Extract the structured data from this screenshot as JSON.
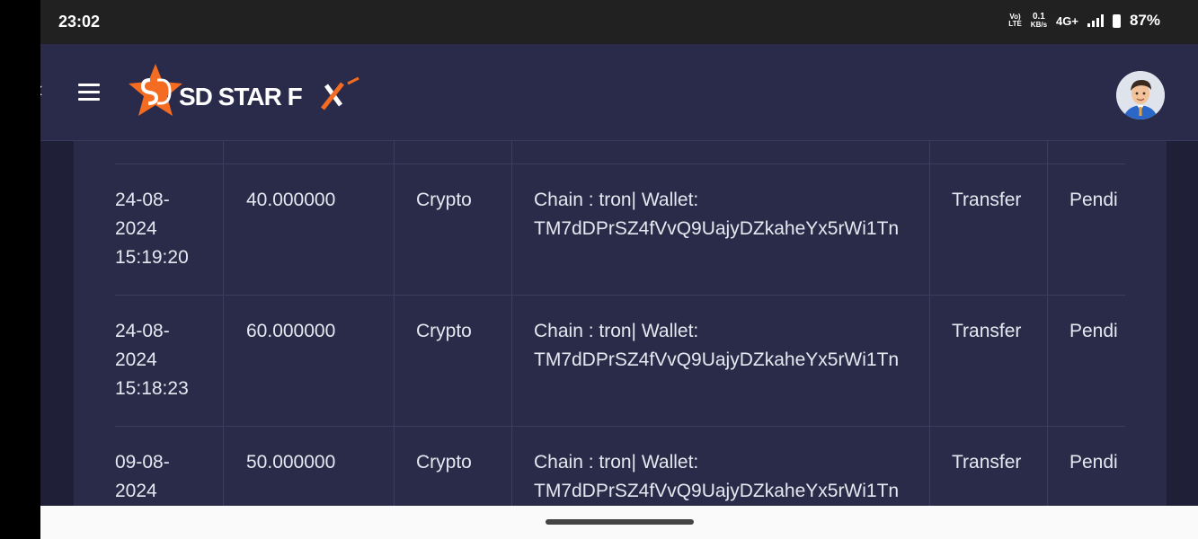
{
  "status_bar": {
    "time": "23:02",
    "volte_top": "Vo)",
    "volte_bottom": "LTE",
    "speed_value": "0.1",
    "speed_unit": "KB/s",
    "network": "4G+",
    "battery": "87%"
  },
  "header": {
    "logo_text": "SDSTARFX",
    "menu_icon": "hamburger-menu-icon",
    "avatar_icon": "user-avatar"
  },
  "colors": {
    "header_bg": "#2a2b4a",
    "card_bg": "#2a2b48",
    "page_bg": "#1f1f38",
    "accent_orange": "#f36c21",
    "text": "#e6e7f0"
  },
  "table": {
    "rows": [
      {
        "date_d": "24-08-",
        "date_y": "2024",
        "time": "15:19:20",
        "amount": "40.000000",
        "method": "Crypto",
        "details_1": "Chain : tron| Wallet:",
        "details_2": "TM7dDPrSZ4fVvQ9UajyDZkaheYx5rWi1Tn",
        "type": "Transfer",
        "status": "Pendi"
      },
      {
        "date_d": "24-08-",
        "date_y": "2024",
        "time": "15:18:23",
        "amount": "60.000000",
        "method": "Crypto",
        "details_1": "Chain : tron| Wallet:",
        "details_2": "TM7dDPrSZ4fVvQ9UajyDZkaheYx5rWi1Tn",
        "type": "Transfer",
        "status": "Pendi"
      },
      {
        "date_d": "09-08-",
        "date_y": "2024",
        "time": "",
        "amount": "50.000000",
        "method": "Crypto",
        "details_1": "Chain : tron| Wallet:",
        "details_2": "TM7dDPrSZ4fVvQ9UajyDZkaheYx5rWi1Tn",
        "type": "Transfer",
        "status": "Pendi"
      }
    ]
  }
}
